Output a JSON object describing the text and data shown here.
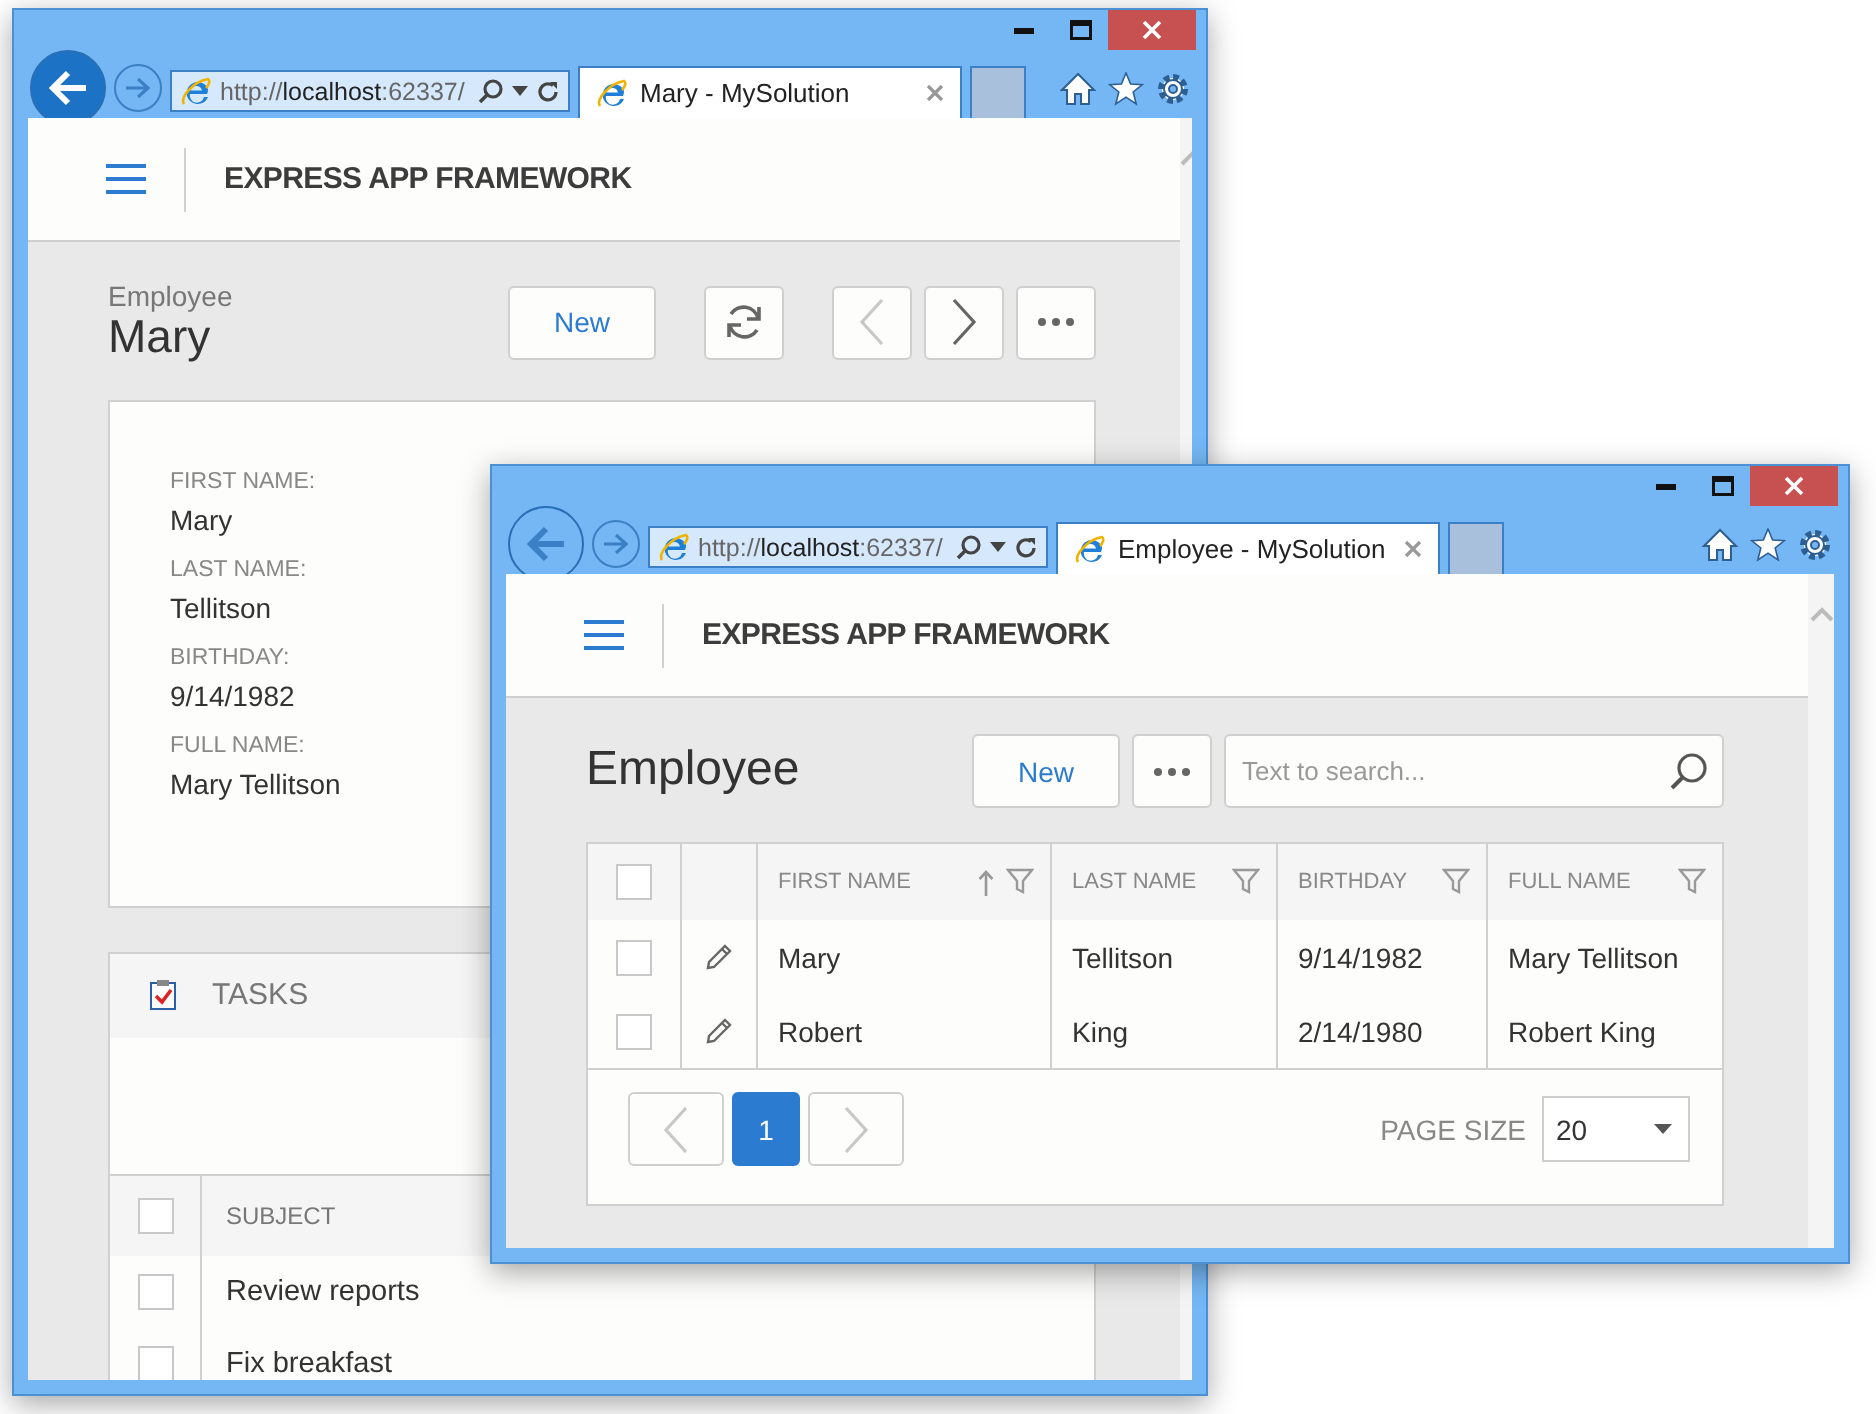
{
  "detail_window": {
    "browser": {
      "back_enabled": true,
      "address": {
        "scheme": "http://",
        "host": "localhost",
        "rest": ":62337/"
      },
      "tab_title": "Mary - MySolution"
    },
    "app_title": "EXPRESS APP FRAMEWORK",
    "caption": "Employee",
    "heading": "Mary",
    "new_button": "New",
    "nav_buttons": [
      {
        "kind": "refresh",
        "disabled": false
      },
      {
        "kind": "previous",
        "disabled": true
      },
      {
        "kind": "next",
        "disabled": false
      },
      {
        "kind": "more",
        "disabled": false
      }
    ],
    "fields": [
      {
        "label": "FIRST NAME:",
        "value": "Mary"
      },
      {
        "label": "LAST NAME:",
        "value": "Tellitson"
      },
      {
        "label": "BIRTHDAY:",
        "value": "9/14/1982"
      },
      {
        "label": "FULL NAME:",
        "value": "Mary Tellitson"
      }
    ],
    "tasks": {
      "title": "TASKS",
      "column": "SUBJECT",
      "header_checked": false,
      "rows": [
        {
          "subject": "Review reports",
          "checked": false
        },
        {
          "subject": "Fix breakfast",
          "checked": false
        }
      ]
    }
  },
  "list_window": {
    "browser": {
      "back_enabled": false,
      "address": {
        "scheme": "http://",
        "host": "localhost",
        "rest": ":62337/"
      },
      "tab_title": "Employee - MySolution"
    },
    "app_title": "EXPRESS APP FRAMEWORK",
    "heading": "Employee",
    "new_button": "New",
    "search": {
      "placeholder": "Text to search..."
    },
    "grid": {
      "header_checked": false,
      "columns": [
        {
          "label": "FIRST NAME",
          "sorted": true
        },
        {
          "label": "LAST NAME",
          "sorted": false
        },
        {
          "label": "BIRTHDAY",
          "sorted": false
        },
        {
          "label": "FULL NAME",
          "sorted": false
        }
      ],
      "rows": [
        {
          "checked": false,
          "cells": [
            "Mary",
            "Tellitson",
            "9/14/1982",
            "Mary Tellitson"
          ]
        },
        {
          "checked": false,
          "cells": [
            "Robert",
            "King",
            "2/14/1980",
            "Robert King"
          ]
        }
      ],
      "pager": {
        "previous_disabled": true,
        "next_disabled": true,
        "pages": [
          {
            "label": "1",
            "selected": true
          }
        ],
        "page_size_label": "PAGE SIZE",
        "page_size": "20"
      }
    }
  }
}
